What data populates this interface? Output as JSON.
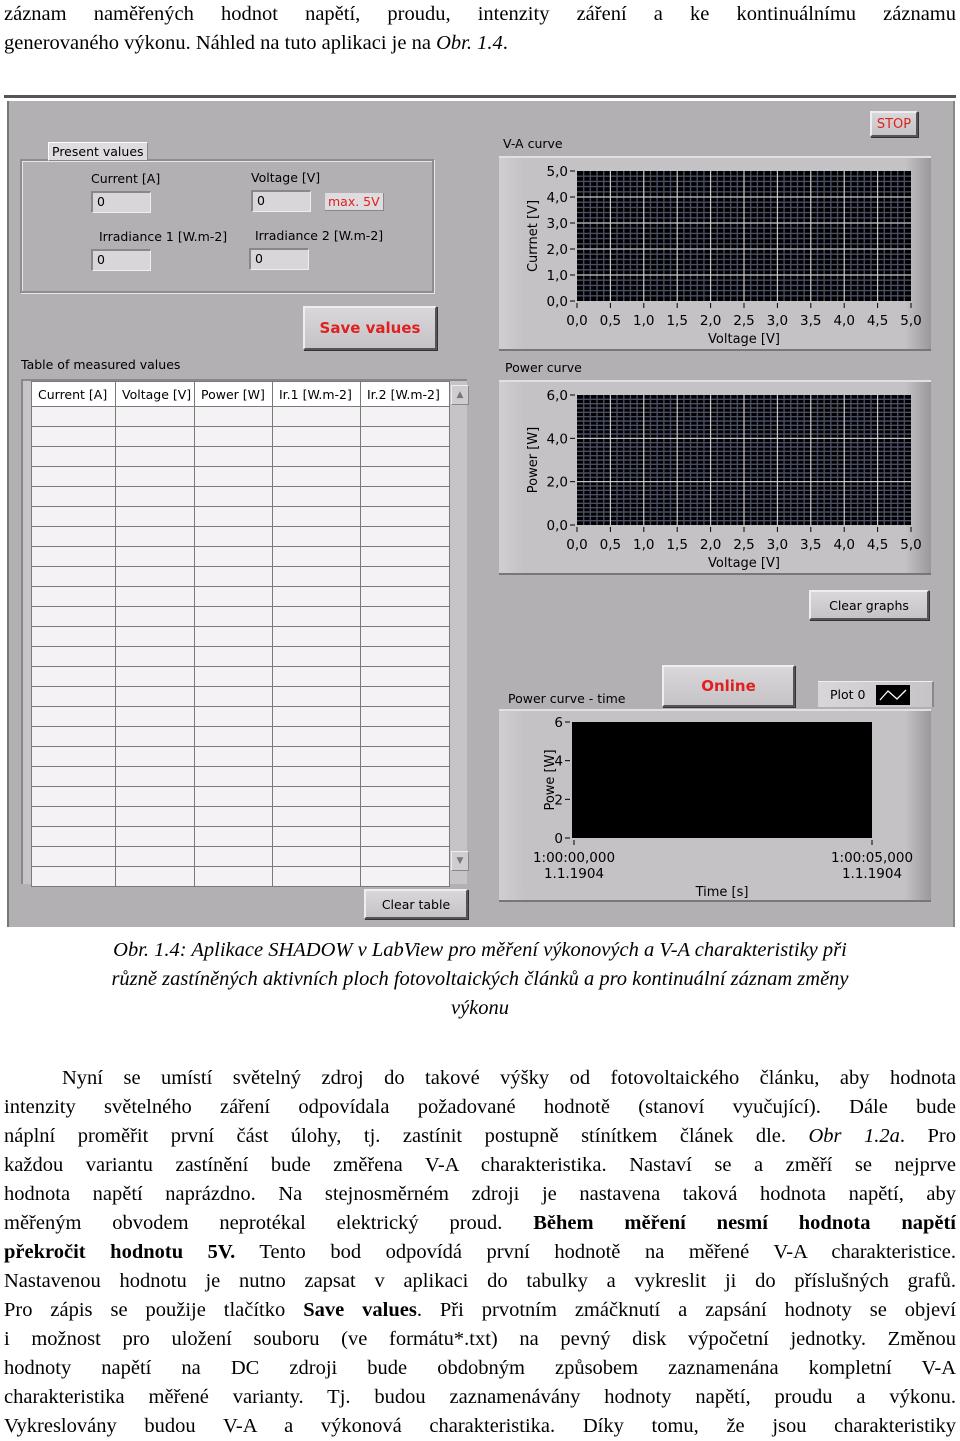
{
  "document": {
    "intro_lines": [
      "záznam naměřených hodnot napětí, proudu, intenzity záření a ke kontinuálnímu záznamu",
      "generovaného výkonu. Náhled na tuto aplikaci je na "
    ],
    "intro_ref": "Obr. 1.4",
    "intro_end": ".",
    "caption_lines": [
      "Obr. 1.4: Aplikace SHADOW v LabView pro měření výkonových a V-A charakteristiky při",
      "různě zastíněných aktivních ploch fotovoltaických článků a pro kontinuální záznam změny",
      "výkonu"
    ],
    "body": {
      "l1": "Nyní se umístí světelný zdroj do takové výšky od fotovoltaického článku, aby hodnota",
      "l2": "intenzity světelného záření odpovídala požadované hodnotě (stanoví vyučující). Dále bude",
      "l3a": "náplní proměřit první část úlohy, tj. zastínit postupně stínítkem článek dle. ",
      "l3ref": "Obr 1.2a",
      "l3b": ". Pro",
      "l4": "každou variantu zastínění bude změřena V-A charakteristika. Nastaví se a změří se nejprve",
      "l5": "hodnota napětí naprázdno. Na stejnosměrném zdroji je nastavena taková hodnota napětí, aby",
      "l6a": "měřeným obvodem neprotékal elektrický proud. ",
      "l6b": "Během měření nesmí hodnota napětí",
      "l7a": "překročit hodnotu 5V.",
      "l7b": " Tento bod odpovídá první hodnotě na měřené V-A charakteristice.",
      "l8": "Nastavenou hodnotu je nutno zapsat v aplikaci do tabulky a vykreslit ji do příslušných grafů.",
      "l9a": "Pro zápis se použije tlačítko ",
      "l9b": "Save values",
      "l9c": ". Při prvotním zmáčknutí a zapsání hodnoty se objeví",
      "l10": "i možnost pro uložení souboru (ve formátu*.txt) na pevný disk výpočetní jednotky. Změnou",
      "l11": "hodnoty napětí na DC zdroji bude obdobným způsobem zaznamenána kompletní V-A",
      "l12": "charakteristika měřené varianty. Tj. budou zaznamenávány hodnoty napětí, proudu a výkonu.",
      "l13": "Vykreslovány budou V-A a výkonová charakteristika. Díky tomu, že jsou charakteristiky"
    }
  },
  "app": {
    "stop_label": "STOP",
    "present_values": {
      "title": "Present values",
      "current_label": "Current [A]",
      "current_value": "0",
      "voltage_label": "Voltage [V]",
      "voltage_value": "0",
      "voltage_limit": "max. 5V",
      "irr1_label": "Irradiance 1 [W.m-2]",
      "irr1_value": "0",
      "irr2_label": "Irradiance 2 [W.m-2]",
      "irr2_value": "0"
    },
    "save_label": "Save values",
    "table": {
      "title": "Table of measured values",
      "columns": [
        "Current [A]",
        "Voltage [V]",
        "Power [W]",
        "Ir.1 [W.m-2]",
        "Ir.2 [W.m-2]"
      ],
      "row_count": 24,
      "rows": []
    },
    "clear_table_label": "Clear table",
    "clear_graphs_label": "Clear graphs",
    "online_label": "Online",
    "legend_plot": "Plot 0",
    "colors": {
      "accent_red": "#e02020",
      "panel": "#b2b0b2",
      "plot_bg": "#000000"
    }
  },
  "chart_data": [
    {
      "type": "line",
      "title": "V-A curve",
      "xlabel": "Voltage [V]",
      "ylabel": "Currnet [V]",
      "xlim": [
        0,
        5
      ],
      "ylim": [
        0,
        5
      ],
      "x_ticks": [
        "0,0",
        "0,5",
        "1,0",
        "1,5",
        "2,0",
        "2,5",
        "3,0",
        "3,5",
        "4,0",
        "4,5",
        "5,0"
      ],
      "y_ticks": [
        "0,0",
        "1,0",
        "2,0",
        "3,0",
        "4,0",
        "5,0"
      ],
      "grid": true,
      "series": []
    },
    {
      "type": "line",
      "title": "Power curve",
      "xlabel": "Voltage [V]",
      "ylabel": "Power [W]",
      "xlim": [
        0,
        5
      ],
      "ylim": [
        0,
        6
      ],
      "x_ticks": [
        "0,0",
        "0,5",
        "1,0",
        "1,5",
        "2,0",
        "2,5",
        "3,0",
        "3,5",
        "4,0",
        "4,5",
        "5,0"
      ],
      "y_ticks": [
        "0,0",
        "2,0",
        "4,0",
        "6,0"
      ],
      "grid": true,
      "series": []
    },
    {
      "type": "line",
      "title": "Power curve - time",
      "xlabel": "Time [s]",
      "ylabel": "Powe [W]",
      "xlim": [
        "1:00:00,000 1.1.1904",
        "1:00:05,000 1.1.1904"
      ],
      "ylim": [
        0,
        6
      ],
      "x_ticks": [
        [
          "1:00:00,000",
          "1.1.1904"
        ],
        [
          "1:00:05,000",
          "1.1.1904"
        ]
      ],
      "y_ticks": [
        "0",
        "2",
        "4",
        "6"
      ],
      "grid": false,
      "legend": [
        "Plot 0"
      ],
      "legend_position": "top-right",
      "series": [
        {
          "name": "Plot 0",
          "values": []
        }
      ]
    }
  ]
}
